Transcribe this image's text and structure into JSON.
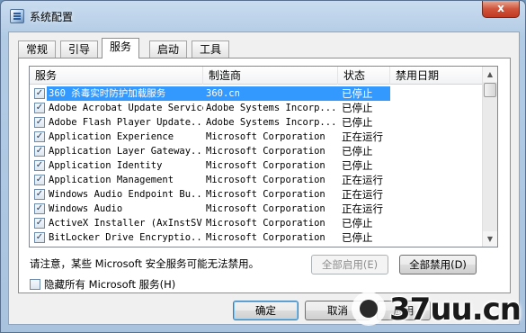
{
  "window": {
    "title": "系统配置",
    "close_label": "x"
  },
  "tabs": [
    {
      "label": "常规"
    },
    {
      "label": "引导"
    },
    {
      "label": "服务"
    },
    {
      "label": "启动"
    },
    {
      "label": "工具"
    }
  ],
  "active_tab": "服务",
  "columns": {
    "service": "服务",
    "manufacturer": "制造商",
    "status": "状态",
    "disabled_date": "禁用日期"
  },
  "services": [
    {
      "name": "360 杀毒实时防护加载服务",
      "manufacturer": "360.cn",
      "status": "已停止",
      "checked": true,
      "selected": true
    },
    {
      "name": "Adobe Acrobat Update Service",
      "manufacturer": "Adobe Systems Incorp...",
      "status": "已停止",
      "checked": true
    },
    {
      "name": "Adobe Flash Player Update...",
      "manufacturer": "Adobe Systems Incorp...",
      "status": "已停止",
      "checked": true
    },
    {
      "name": "Application Experience",
      "manufacturer": "Microsoft Corporation",
      "status": "正在运行",
      "checked": true
    },
    {
      "name": "Application Layer Gateway...",
      "manufacturer": "Microsoft Corporation",
      "status": "已停止",
      "checked": true
    },
    {
      "name": "Application Identity",
      "manufacturer": "Microsoft Corporation",
      "status": "已停止",
      "checked": true
    },
    {
      "name": "Application Management",
      "manufacturer": "Microsoft Corporation",
      "status": "正在运行",
      "checked": true
    },
    {
      "name": "Windows Audio Endpoint Bu...",
      "manufacturer": "Microsoft Corporation",
      "status": "正在运行",
      "checked": true
    },
    {
      "name": "Windows Audio",
      "manufacturer": "Microsoft Corporation",
      "status": "正在运行",
      "checked": true
    },
    {
      "name": "ActiveX Installer (AxInstSV)",
      "manufacturer": "Microsoft Corporation",
      "status": "已停止",
      "checked": true
    },
    {
      "name": "BitLocker Drive Encryptio...",
      "manufacturer": "Microsoft Corporation",
      "status": "已停止",
      "checked": true
    }
  ],
  "notice": "请注意，某些 Microsoft 安全服务可能无法禁用。",
  "buttons": {
    "enable_all": "全部启用(E)",
    "disable_all": "全部禁用(D)",
    "ok": "确定",
    "cancel": "取消",
    "apply": "应用"
  },
  "hide_ms_label": "隐藏所有 Microsoft 服务(H)",
  "watermark": "37uu.cn"
}
